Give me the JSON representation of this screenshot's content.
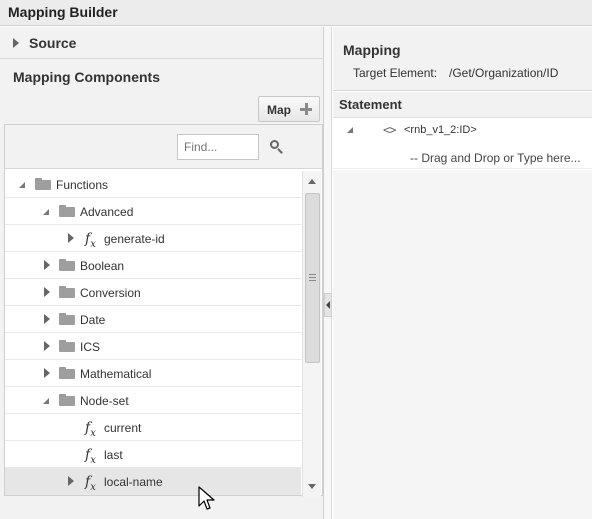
{
  "window": {
    "title": "Mapping Builder"
  },
  "left": {
    "source_label": "Source",
    "components_title": "Mapping Components",
    "map_button": "Map",
    "find_placeholder": "Find...",
    "tree": [
      {
        "label": "Functions",
        "kind": "folder",
        "state": "expanded",
        "level": 0
      },
      {
        "label": "Advanced",
        "kind": "folder",
        "state": "expanded",
        "level": 1
      },
      {
        "label": "generate-id",
        "kind": "function",
        "state": "collapsed",
        "level": 2
      },
      {
        "label": "Boolean",
        "kind": "folder",
        "state": "collapsed",
        "level": 1
      },
      {
        "label": "Conversion",
        "kind": "folder",
        "state": "collapsed",
        "level": 1
      },
      {
        "label": "Date",
        "kind": "folder",
        "state": "collapsed",
        "level": 1
      },
      {
        "label": "ICS",
        "kind": "folder",
        "state": "collapsed",
        "level": 1
      },
      {
        "label": "Mathematical",
        "kind": "folder",
        "state": "collapsed",
        "level": 1
      },
      {
        "label": "Node-set",
        "kind": "folder",
        "state": "expanded",
        "level": 1
      },
      {
        "label": "current",
        "kind": "function",
        "state": "leaf",
        "level": 2
      },
      {
        "label": "last",
        "kind": "function",
        "state": "leaf",
        "level": 2
      },
      {
        "label": "local-name",
        "kind": "function",
        "state": "collapsed",
        "level": 2,
        "hovered": true
      }
    ]
  },
  "right": {
    "mapping_title": "Mapping",
    "target_label": "Target Element:",
    "target_value": "/Get/Organization/ID",
    "statement_title": "Statement",
    "element_tag": "<rnb_v1_2:ID>",
    "drop_hint": "-- Drag and Drop or Type here..."
  },
  "icons": {
    "expand": "triangle-right-icon",
    "collapse": "triangle-down-icon",
    "folder": "folder-icon",
    "function": "fx-function-icon",
    "search": "search-icon",
    "add": "plus-icon",
    "code": "code-brackets-icon"
  },
  "colors": {
    "panel": "#f2f2f2",
    "hover_row": "#e6e6e6",
    "border": "#cfcfcf"
  }
}
